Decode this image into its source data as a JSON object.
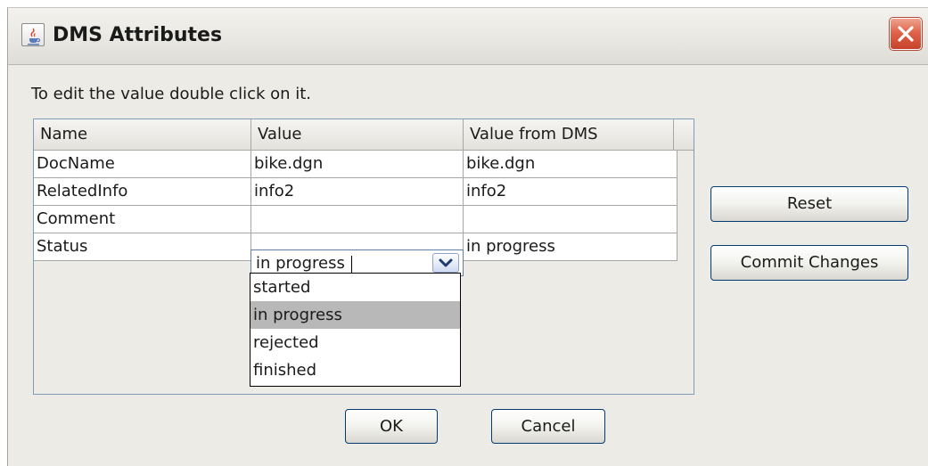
{
  "window": {
    "title": "DMS Attributes",
    "icon": "java-cup-icon",
    "close_icon": "close-icon"
  },
  "instructions": "To edit the value double click on it.",
  "table": {
    "headers": [
      "Name",
      "Value",
      "Value from DMS"
    ],
    "rows": [
      {
        "name": "DocName",
        "value": "bike.dgn",
        "dms": "bike.dgn"
      },
      {
        "name": "RelatedInfo",
        "value": "info2",
        "dms": "info2"
      },
      {
        "name": "Comment",
        "value": "",
        "dms": ""
      },
      {
        "name": "Status",
        "value": "in progress",
        "dms": "in progress"
      }
    ]
  },
  "status_editor": {
    "current_value": "in progress",
    "arrow_icon": "chevron-down-icon",
    "options": [
      "started",
      "in progress",
      "rejected",
      "finished"
    ],
    "highlighted_option": "in progress"
  },
  "buttons": {
    "reset": "Reset",
    "commit": "Commit Changes",
    "ok": "OK",
    "cancel": "Cancel"
  },
  "colors": {
    "dialog_background": "#ecebe6",
    "close_button": "#e0634a",
    "selected_option": "#b8b8b8",
    "table_border": "#7f9db9"
  }
}
